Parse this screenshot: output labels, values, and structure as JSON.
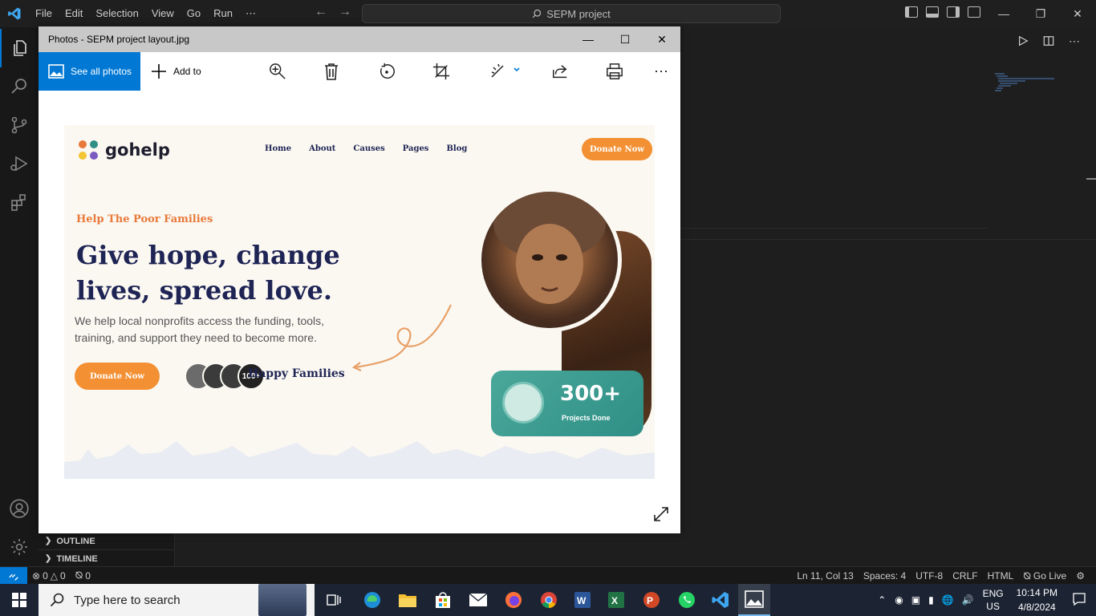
{
  "vscode": {
    "menu": [
      "File",
      "Edit",
      "Selection",
      "View",
      "Go",
      "Run",
      "⋯"
    ],
    "search_label": "SEPM project",
    "accent": "#0078d4"
  },
  "sidebar": {
    "outline_label": "OUTLINE",
    "timeline_label": "TIMELINE"
  },
  "statusbar": {
    "errors": "0",
    "warnings": "0",
    "ports": "0",
    "position": "Ln 11, Col 13",
    "spaces": "Spaces: 4",
    "encoding": "UTF-8",
    "eol": "CRLF",
    "language": "HTML",
    "golive": "Go Live"
  },
  "photos": {
    "title": "Photos - SEPM project layout.jpg",
    "see_all": "See all photos",
    "add_to": "Add to"
  },
  "gohelp": {
    "logo": "gohelp",
    "nav": [
      "Home",
      "About",
      "Causes",
      "Pages",
      "Blog"
    ],
    "donate_top": "Donate Now",
    "eyebrow": "Help The Poor Families",
    "headline": "Give hope, change lives, spread love.",
    "subtext": "We help local nonprofits access the funding, tools, training, and support they need to become more.",
    "donate_btn": "Donate Now",
    "avatars_count": "100+",
    "happy": "Happy Families",
    "stat_number": "300+",
    "stat_label": "Projects Done",
    "accent": "#f39033",
    "navy": "#1e2454"
  },
  "taskbar": {
    "search_placeholder": "Type here to search",
    "lang_top": "ENG",
    "lang_bottom": "US",
    "time": "10:14 PM",
    "date": "4/8/2024"
  }
}
